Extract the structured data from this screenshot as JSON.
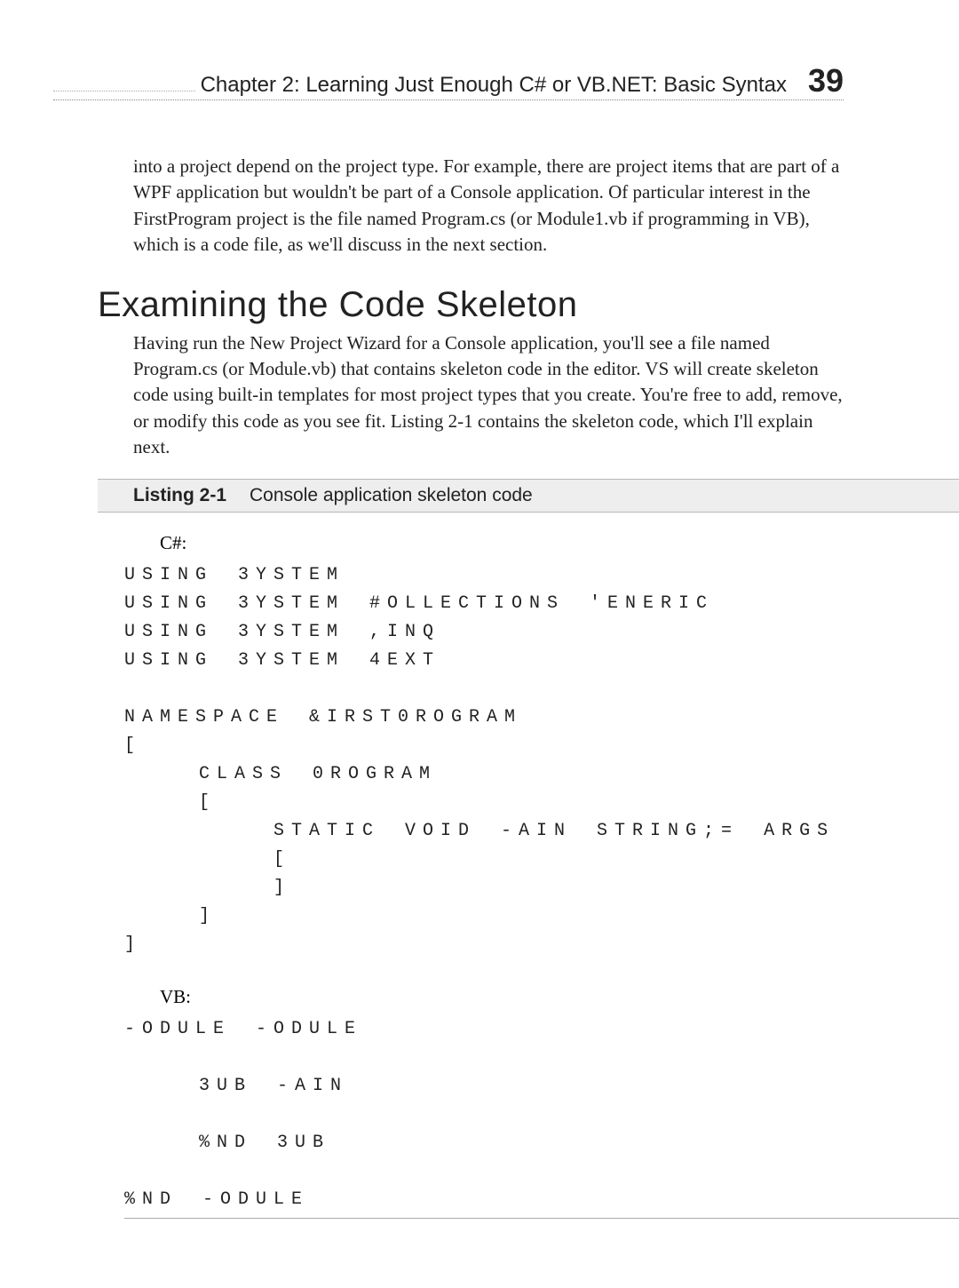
{
  "header": {
    "chapter_text": "Chapter 2:   Learning Just Enough C# or VB.NET: Basic Syntax",
    "page_number": "39"
  },
  "intro_paragraph": "into a project depend on the project type. For example, there are project items that are part of a WPF application but wouldn't be part of a Console application. Of particular interest in the FirstProgram project is the file named Program.cs (or Module1.vb if programming in VB), which is a code file, as we'll discuss in the next section.",
  "section_heading": "Examining the Code Skeleton",
  "section_paragraph": "Having run the New Project Wizard for a Console application, you'll see a file named Program.cs (or Module.vb) that contains skeleton code in the editor. VS will create skeleton code using built-in templates for most project types that you create. You're free to add, remove, or modify this code as you see fit. Listing 2-1 contains the skeleton code, which I'll explain next.",
  "listing": {
    "label": "Listing 2-1",
    "caption": "Console application skeleton code"
  },
  "code": {
    "csharp_label": "C#:",
    "csharp_lines": "USING 3YSTEM\nUSING 3YSTEM #OLLECTIONS 'ENERIC\nUSING 3YSTEM ,INQ\nUSING 3YSTEM 4EXT\n\nNAMESPACE &IRST0ROGRAM\n[\n   CLASS 0ROGRAM\n   [\n      STATIC VOID -AIN STRING;= ARGS\n      [\n      ]\n   ]\n]",
    "vb_label": "VB:",
    "vb_lines": "-ODULE -ODULE\n\n   3UB -AIN\n\n   %ND 3UB\n\n%ND -ODULE"
  }
}
